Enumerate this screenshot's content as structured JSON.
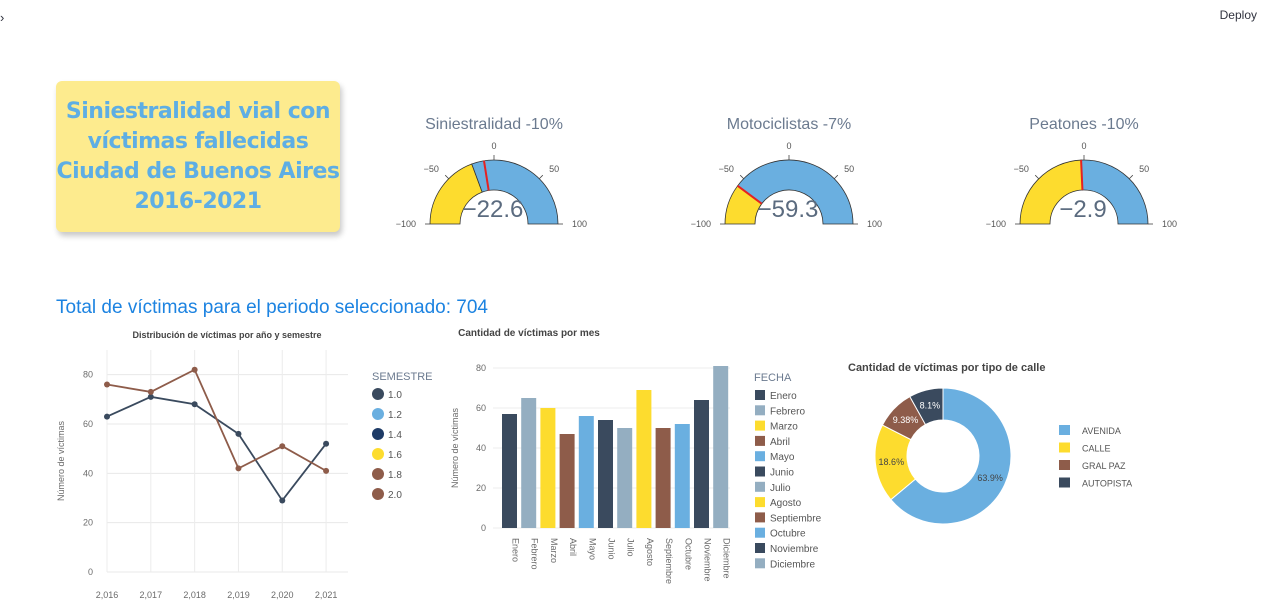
{
  "header": {
    "expand_icon": "chevron-right-icon",
    "deploy_label": "Deploy"
  },
  "title_card": {
    "lines": [
      "Siniestralidad vial con",
      "víctimas fallecidas",
      "Ciudad de Buenos Aires",
      "2016-2021"
    ]
  },
  "gauges": [
    {
      "title": "Siniestralidad -10%",
      "value": -22.6,
      "display": "−22.6",
      "threshold": -10,
      "range": [
        -100,
        100
      ]
    },
    {
      "title": "Motociclistas -7%",
      "value": -59.3,
      "display": "−59.3",
      "threshold": -59.3,
      "range": [
        -100,
        100
      ]
    },
    {
      "title": "Peatones -10%",
      "value": -2.9,
      "display": "−2.9",
      "threshold": -2.9,
      "range": [
        -100,
        100
      ]
    }
  ],
  "gauge_ticks": [
    "−100",
    "−50",
    "0",
    "50",
    "100"
  ],
  "total_heading": "Total de víctimas para el periodo seleccionado: 704",
  "colors": {
    "yellow": "#fddc2e",
    "blue": "#6aafe0",
    "red": "#e52222",
    "navy": "#3a4a5e",
    "brown": "#8e5c4a",
    "grey": "#94aec1",
    "darkblue": "#2b3d54"
  },
  "chart_data": [
    {
      "type": "line",
      "title": "Distribución de víctimas por año y semestre",
      "ylabel": "Número de víctimas",
      "xlabel": "",
      "x_ticks": [
        "2,016",
        "2,017",
        "2,018",
        "2,019",
        "2,020",
        "2,021"
      ],
      "x_range": [
        2016,
        2021.5
      ],
      "ylim": [
        0,
        90
      ],
      "y_ticks": [
        0,
        20,
        40,
        60,
        80
      ],
      "legend_title": "SEMESTRE",
      "legend": [
        {
          "label": "1.0",
          "color": "#3a4a5e"
        },
        {
          "label": "1.2",
          "color": "#6aafe0"
        },
        {
          "label": "1.4",
          "color": "#1e3b66"
        },
        {
          "label": "1.6",
          "color": "#fddc2e"
        },
        {
          "label": "1.8",
          "color": "#8e5c4a"
        },
        {
          "label": "2.0",
          "color": "#8e5c4a"
        }
      ],
      "series": [
        {
          "color": "#3a4a5e",
          "points": [
            [
              2016,
              63
            ],
            [
              2017,
              71
            ],
            [
              2018,
              68
            ],
            [
              2019,
              56
            ],
            [
              2020,
              29
            ],
            [
              2021,
              52
            ]
          ]
        },
        {
          "color": "#8e5c4a",
          "points": [
            [
              2016,
              76
            ],
            [
              2017,
              73
            ],
            [
              2018,
              82
            ],
            [
              2019,
              42
            ],
            [
              2020,
              51
            ],
            [
              2021,
              41
            ]
          ]
        }
      ]
    },
    {
      "type": "bar",
      "title": "Cantidad de víctimas por mes",
      "ylabel": "Número de víctimas",
      "ylim": [
        0,
        80
      ],
      "y_ticks": [
        0,
        20,
        40,
        60,
        80
      ],
      "legend_title": "FECHA",
      "categories": [
        "Enero",
        "Febrero",
        "Marzo",
        "Abril",
        "Mayo",
        "Junio",
        "Julio",
        "Agosto",
        "Septiembre",
        "Octubre",
        "Noviembre",
        "Diciembre"
      ],
      "values": [
        57,
        65,
        60,
        47,
        56,
        54,
        50,
        69,
        50,
        52,
        64,
        81
      ],
      "colors": [
        "#3a4a5e",
        "#94aec1",
        "#fddc2e",
        "#8e5c4a",
        "#6aafe0",
        "#3a4a5e",
        "#94aec1",
        "#fddc2e",
        "#8e5c4a",
        "#6aafe0",
        "#3a4a5e",
        "#94aec1"
      ]
    },
    {
      "type": "pie",
      "title": "Cantidad de víctimas por tipo de calle",
      "slices": [
        {
          "label": "AVENIDA",
          "value": 63.9,
          "text": "63.9%",
          "color": "#6aafe0"
        },
        {
          "label": "CALLE",
          "value": 18.6,
          "text": "18.6%",
          "color": "#fddc2e"
        },
        {
          "label": "GRAL PAZ",
          "value": 9.38,
          "text": "9.38%",
          "color": "#8e5c4a"
        },
        {
          "label": "AUTOPISTA",
          "value": 8.1,
          "text": "8.1%",
          "color": "#3a4a5e"
        }
      ]
    }
  ]
}
